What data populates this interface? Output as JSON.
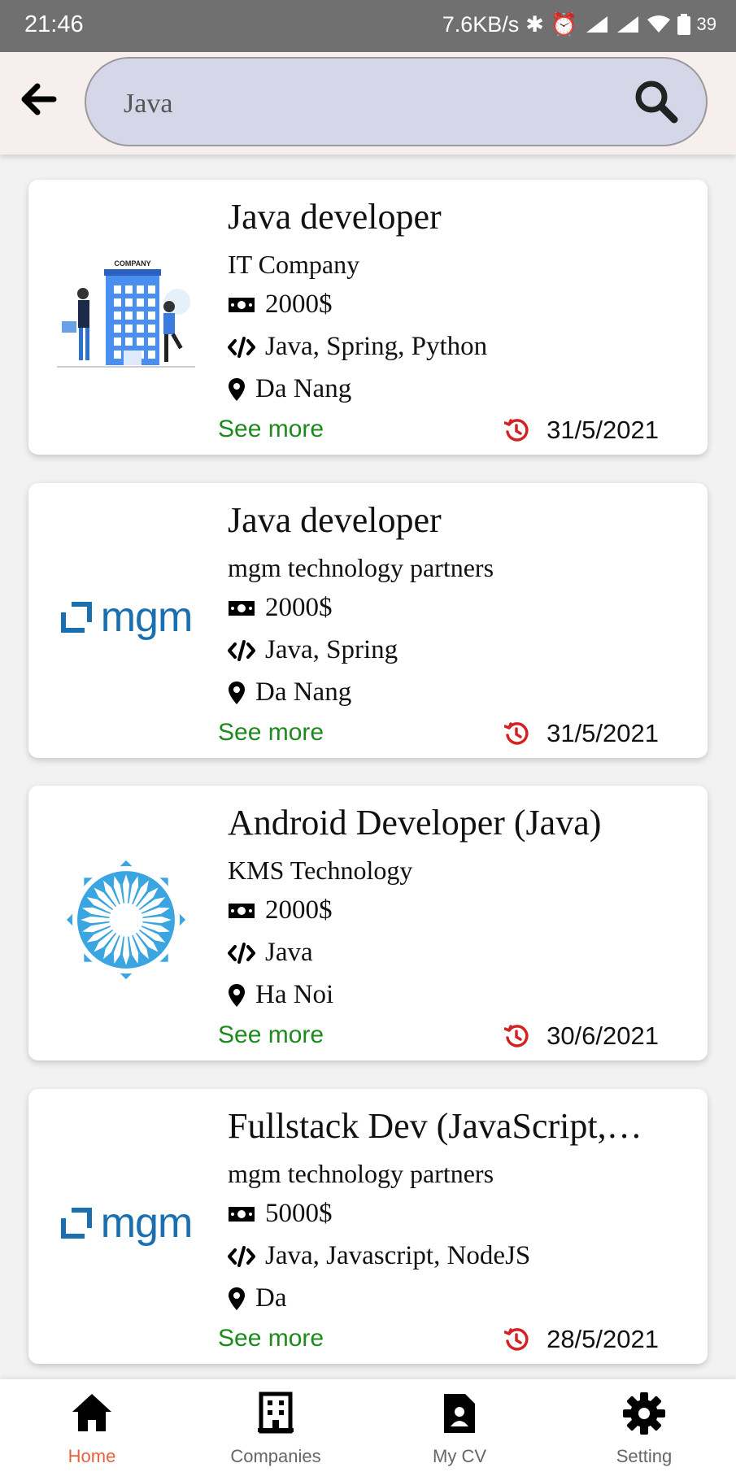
{
  "status_bar": {
    "time": "21:46",
    "net_speed": "7.6KB/s",
    "battery": "39"
  },
  "search": {
    "value": "Java"
  },
  "jobs": [
    {
      "title": "Java developer",
      "company": "IT Company",
      "salary": "2000$",
      "skills": "Java, Spring, Python",
      "location": "Da Nang",
      "see_more": "See more",
      "date": "31/5/2021",
      "logo": "company-building-illustration"
    },
    {
      "title": "Java developer",
      "company": "mgm technology partners",
      "salary": "2000$",
      "skills": "Java, Spring",
      "location": "Da Nang",
      "see_more": "See more",
      "date": "31/5/2021",
      "logo": "mgm-logo",
      "logo_text": "mgm"
    },
    {
      "title": "Android Developer (Java)",
      "company": "KMS Technology",
      "salary": "2000$",
      "skills": "Java",
      "location": "Ha Noi",
      "see_more": "See more",
      "date": "30/6/2021",
      "logo": "kms-sun-logo"
    },
    {
      "title": "Fullstack Dev (JavaScript,…",
      "company": "mgm technology partners",
      "salary": "5000$",
      "skills": "Java, Javascript, NodeJS",
      "location": "Da",
      "see_more": "See more",
      "date": "28/5/2021",
      "logo": "mgm-logo",
      "logo_text": "mgm"
    }
  ],
  "nav": [
    {
      "label": "Home",
      "icon": "home-icon",
      "active": true
    },
    {
      "label": "Companies",
      "icon": "building-icon",
      "active": false
    },
    {
      "label": "My CV",
      "icon": "cv-document-icon",
      "active": false
    },
    {
      "label": "Setting",
      "icon": "gear-icon",
      "active": false
    }
  ],
  "colors": {
    "accent_green": "#1e8a1e",
    "date_icon_red": "#d32222",
    "active_nav": "#e8623e",
    "mgm_blue": "#1a6fb0",
    "kms_blue": "#3aa5e0"
  }
}
